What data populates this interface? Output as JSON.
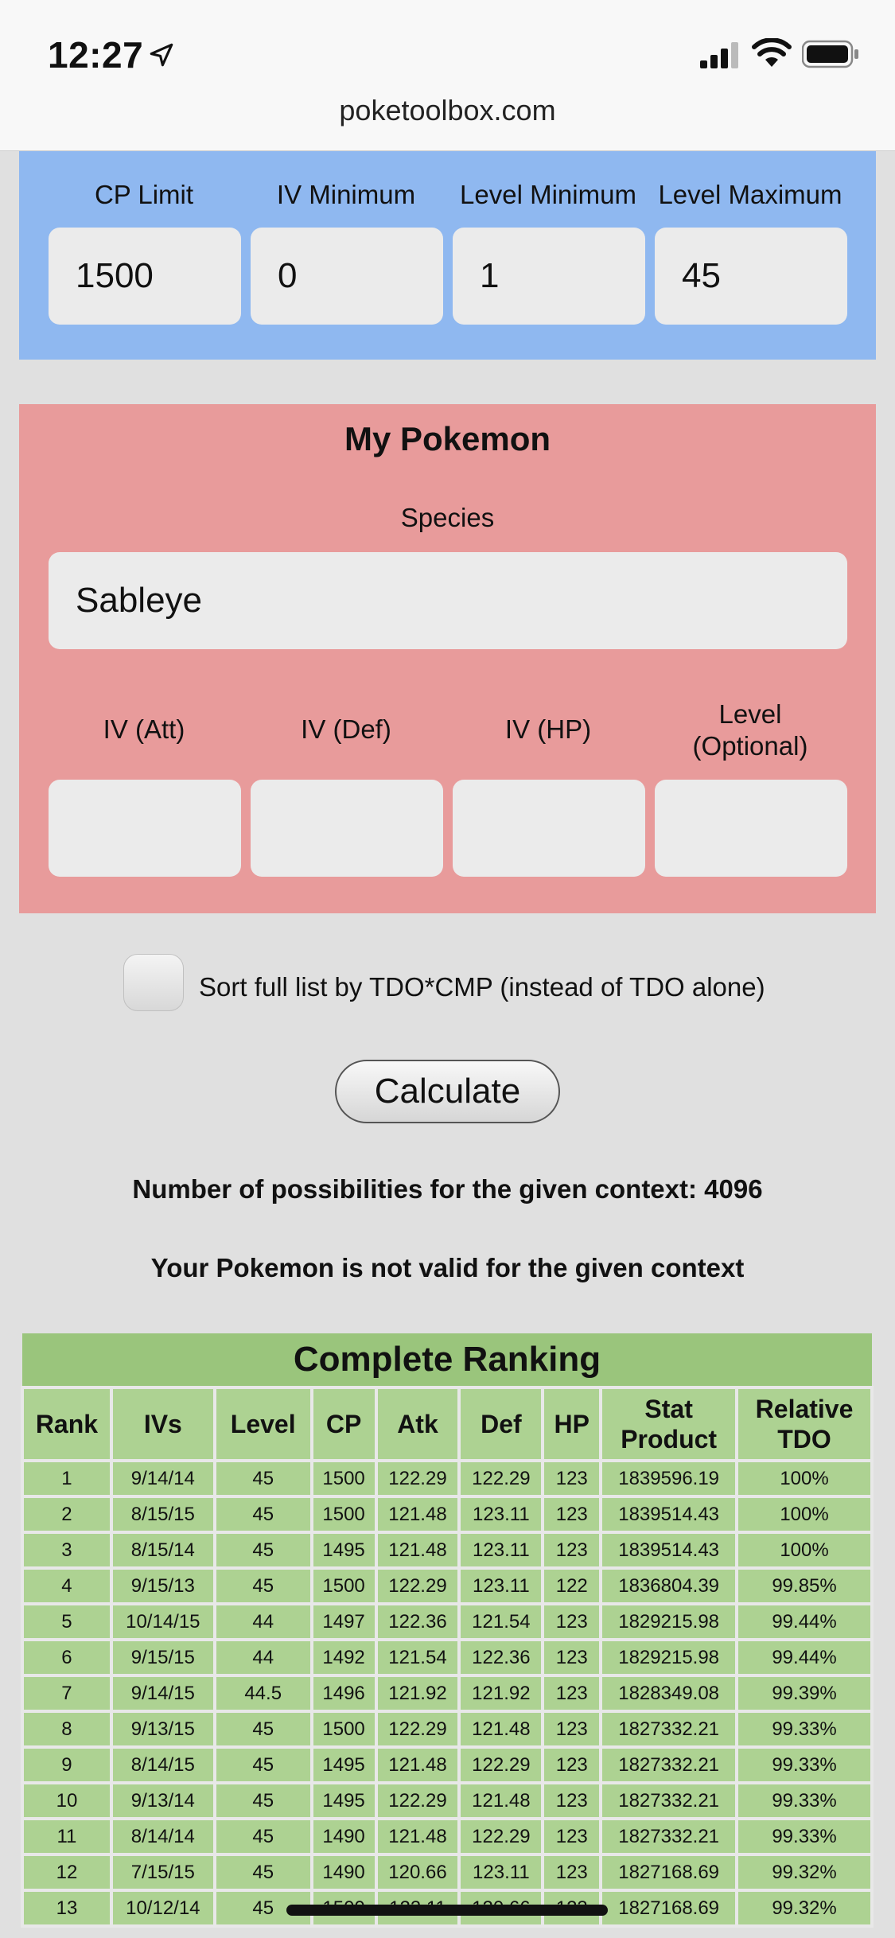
{
  "status_bar": {
    "time": "12:27",
    "url": "poketoolbox.com"
  },
  "context": {
    "fields": [
      {
        "label": "CP Limit",
        "value": "1500"
      },
      {
        "label": "IV Minimum",
        "value": "0"
      },
      {
        "label": "Level Minimum",
        "value": "1"
      },
      {
        "label": "Level Maximum",
        "value": "45"
      }
    ]
  },
  "my_pokemon": {
    "title": "My Pokemon",
    "species_label": "Species",
    "species_value": "Sableye",
    "iv_fields": [
      {
        "label": "IV (Att)",
        "value": ""
      },
      {
        "label": "IV (Def)",
        "value": ""
      },
      {
        "label": "IV (HP)",
        "value": ""
      },
      {
        "label": "Level\n(Optional)",
        "value": ""
      }
    ]
  },
  "sort_option": {
    "label": "Sort full list by TDO*CMP (instead of TDO alone)",
    "checked": false
  },
  "calculate_label": "Calculate",
  "possibilities_text": "Number of possibilities for the given context: 4096",
  "validity_text": "Your Pokemon is not valid for the given context",
  "ranking": {
    "title": "Complete Ranking",
    "columns": [
      "Rank",
      "IVs",
      "Level",
      "CP",
      "Atk",
      "Def",
      "HP",
      "Stat Product",
      "Relative TDO"
    ],
    "rows": [
      [
        "1",
        "9/14/14",
        "45",
        "1500",
        "122.29",
        "122.29",
        "123",
        "1839596.19",
        "100%"
      ],
      [
        "2",
        "8/15/15",
        "45",
        "1500",
        "121.48",
        "123.11",
        "123",
        "1839514.43",
        "100%"
      ],
      [
        "3",
        "8/15/14",
        "45",
        "1495",
        "121.48",
        "123.11",
        "123",
        "1839514.43",
        "100%"
      ],
      [
        "4",
        "9/15/13",
        "45",
        "1500",
        "122.29",
        "123.11",
        "122",
        "1836804.39",
        "99.85%"
      ],
      [
        "5",
        "10/14/15",
        "44",
        "1497",
        "122.36",
        "121.54",
        "123",
        "1829215.98",
        "99.44%"
      ],
      [
        "6",
        "9/15/15",
        "44",
        "1492",
        "121.54",
        "122.36",
        "123",
        "1829215.98",
        "99.44%"
      ],
      [
        "7",
        "9/14/15",
        "44.5",
        "1496",
        "121.92",
        "121.92",
        "123",
        "1828349.08",
        "99.39%"
      ],
      [
        "8",
        "9/13/15",
        "45",
        "1500",
        "122.29",
        "121.48",
        "123",
        "1827332.21",
        "99.33%"
      ],
      [
        "9",
        "8/14/15",
        "45",
        "1495",
        "121.48",
        "122.29",
        "123",
        "1827332.21",
        "99.33%"
      ],
      [
        "10",
        "9/13/14",
        "45",
        "1495",
        "122.29",
        "121.48",
        "123",
        "1827332.21",
        "99.33%"
      ],
      [
        "11",
        "8/14/14",
        "45",
        "1490",
        "121.48",
        "122.29",
        "123",
        "1827332.21",
        "99.33%"
      ],
      [
        "12",
        "7/15/15",
        "45",
        "1490",
        "120.66",
        "123.11",
        "123",
        "1827168.69",
        "99.32%"
      ],
      [
        "13",
        "10/12/14",
        "45",
        "1500",
        "123.11",
        "120.66",
        "123",
        "1827168.69",
        "99.32%"
      ]
    ]
  }
}
